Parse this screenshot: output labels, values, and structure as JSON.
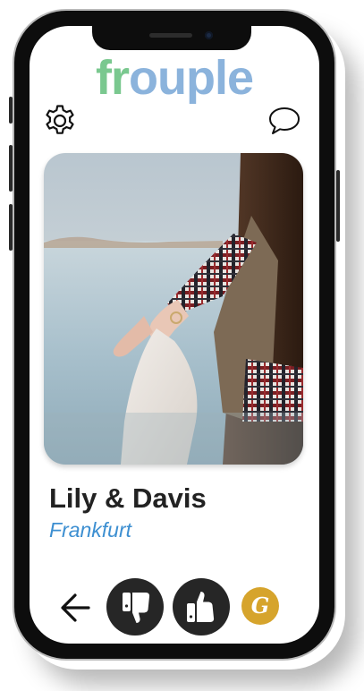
{
  "app": {
    "logo_accent": "fr",
    "logo_rest": "ouple",
    "colors": {
      "logo_green": "#7ac88f",
      "logo_blue": "#8bb3dc",
      "city_blue": "#3d8fd1",
      "button_dark": "#262626",
      "premium_gold": "#d6a42c"
    }
  },
  "header": {
    "left_icon": "gear-icon",
    "right_icon": "chat-bubble-icon"
  },
  "profile": {
    "photo_subject": "couple-holding-hands-lake",
    "name": "Lily & Davis",
    "city": "Frankfurt"
  },
  "actions": {
    "back_icon": "arrow-left-icon",
    "dislike_icon": "thumbs-down-icon",
    "like_icon": "thumbs-up-icon",
    "premium_letter": "G"
  }
}
